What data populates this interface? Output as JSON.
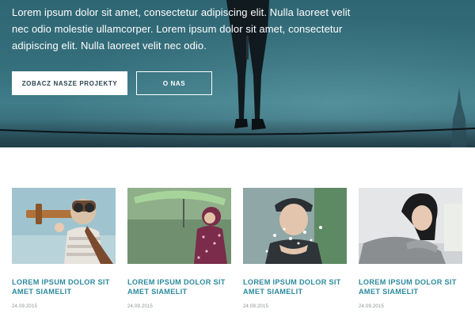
{
  "hero": {
    "text": "Lorem ipsum dolor sit amet, consectetur adipiscing elit. Nulla laoreet velit nec odio molestie ullamcorper. Lorem ipsum dolor sit amet, consectetur adipiscing elit. Nulla laoreet velit nec odio.",
    "primary_button": "ZOBACZ NASZE PROJEKTY",
    "secondary_button": "O NAS"
  },
  "cards": [
    {
      "title": "LOREM IPSUM DOLOR SIT AMET SIAMELIT",
      "date": "24.09.2015",
      "image": "child-aviator-with-toy-plane"
    },
    {
      "title": "LOREM IPSUM DOLOR SIT AMET SIAMELIT",
      "date": "24.09.2015",
      "image": "child-with-green-umbrella-in-rain"
    },
    {
      "title": "LOREM IPSUM DOLOR SIT AMET SIAMELIT",
      "date": "24.09.2015",
      "image": "woman-blowing-snow"
    },
    {
      "title": "LOREM IPSUM DOLOR SIT AMET SIAMELIT",
      "date": "24.09.2015",
      "image": "pensive-woman-on-sofa"
    }
  ],
  "colors": {
    "hero_teal": "#356f7c",
    "card_title": "#2c8a9e",
    "date_gray": "#8a8f93"
  }
}
